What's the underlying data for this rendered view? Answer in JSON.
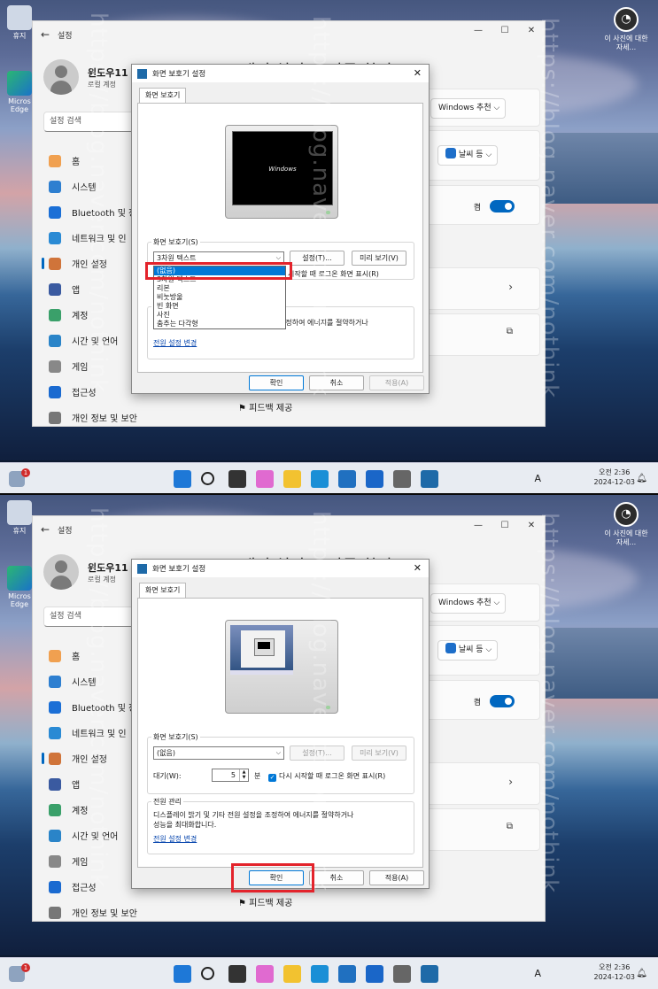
{
  "desktop": {
    "recycle_bin": "휴지",
    "edge": "Micros\nEdge",
    "spotlight": "이 사진에\n대한 자세..."
  },
  "settings": {
    "title": "설정",
    "user_name": "윈도우11",
    "user_type": "로컬 계정",
    "search_placeholder": "설정 검색",
    "page_heading": "개인 설정 > 잠금 화면",
    "nav": [
      "홈",
      "시스템",
      "Bluetooth 및 장",
      "네트워크 및 인",
      "개인 설정",
      "앱",
      "계정",
      "시간 및 언어",
      "게임",
      "접근성",
      "개인 정보 및 보안"
    ],
    "nav_icon_colors": [
      "#f0a050",
      "#2e7fd0",
      "#1b6fd6",
      "#2a8ad4",
      "#d0743a",
      "#3a5aa0",
      "#3aa06a",
      "#2a84c8",
      "#888888",
      "#1a6ad0",
      "#777777"
    ],
    "cards": {
      "windows_spotlight": "Windows 추천",
      "weather": "날씨 등",
      "toggle": "켬"
    },
    "feedback": "피드백 제공"
  },
  "dialog": {
    "title": "화면 보호기 설정",
    "tab": "화면 보호기",
    "preview_text": "Windows",
    "group_label": "화면 보호기(S)",
    "settings_btn": "설정(T)...",
    "preview_btn": "미리 보기(V)",
    "wait_label": "대기(W):",
    "wait_value": "5",
    "minutes": "분",
    "resume_label": "다시 시작할 때 로그온 화면 표시(R)",
    "resume_partial": "시작할 때 로그온 화면 표시(R)",
    "power_group": "전원 관리",
    "power_desc_1": "디스플레이 밝기 및 기타 전원 설정을 조정하여 에너지를 절약하거나",
    "power_desc_2": "성능을 최대화합니다.",
    "power_partial": "조정하여 에너지를 절약하거나",
    "power_link": "전원 설정 변경",
    "ok": "확인",
    "cancel": "취소",
    "apply": "적용(A)",
    "options": [
      "(없음)",
      "3차원 텍스트",
      "리본",
      "비눗방울",
      "빈 화면",
      "사진",
      "춤추는 다각형"
    ],
    "selected_top": "3차원 텍스트",
    "selected_bottom": "(없음)"
  },
  "taskbar": {
    "time": "오전 2:36",
    "date": "2024-12-03",
    "lang": "A",
    "notif_count": "1"
  },
  "watermark": [
    "https://blog.naver.com/nothink",
    "https://blog.naver.com/nothink",
    "https://blog.naver.com/nothink"
  ]
}
